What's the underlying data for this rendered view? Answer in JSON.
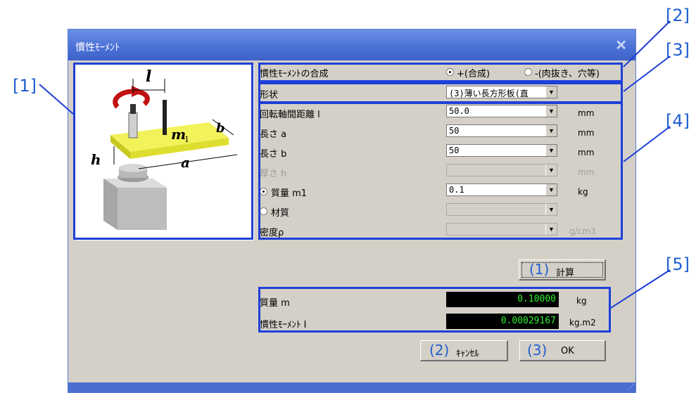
{
  "callouts": [
    "[1]",
    "[2]",
    "[3]",
    "[4]",
    "[5]"
  ],
  "dialog": {
    "title": "慣性ﾓｰﾒﾝﾄ",
    "close_icon": "close-x-icon"
  },
  "illustration": {
    "labels": {
      "l": "l",
      "b": "b",
      "m1": "m",
      "m1_sub": "1",
      "h": "h",
      "a": "a"
    }
  },
  "composition": {
    "label": "慣性ﾓｰﾒﾝﾄの合成",
    "option_plus": "+(合成)",
    "option_minus": "-(肉抜き、穴等)",
    "selected": "plus"
  },
  "shape": {
    "label": "形状",
    "value": "(3)薄い長方形板(直"
  },
  "fields": [
    {
      "label": "回転軸間距離 l",
      "value": "50.0",
      "unit": "mm",
      "enabled": true
    },
    {
      "label": "長さ a",
      "value": "50",
      "unit": "mm",
      "enabled": true
    },
    {
      "label": "長さ b",
      "value": "50",
      "unit": "mm",
      "enabled": true
    },
    {
      "label": "厚さ h",
      "value": "",
      "unit": "mm",
      "enabled": false
    },
    {
      "label": "質量 m1",
      "value": "0.1",
      "unit": "kg",
      "enabled": true
    },
    {
      "label": "材質",
      "value": "",
      "unit": "",
      "enabled": false
    },
    {
      "label": "密度ρ",
      "value": "",
      "unit": "g/cm3",
      "enabled": false
    }
  ],
  "mass_mode": "mass",
  "buttons": {
    "calc_num": "(1)",
    "calc_label": "計算",
    "cancel_num": "(2)",
    "cancel_label": "ｷｬﾝｾﾙ",
    "ok_num": "(3)",
    "ok_label": "OK"
  },
  "results": [
    {
      "label": "質量 m",
      "value": "0.10000",
      "unit": "kg"
    },
    {
      "label": "慣性ﾓｰﾒﾝﾄ I",
      "value": "0.00029167",
      "unit": "kg.m2"
    }
  ],
  "colors": {
    "accent": "#1e3fd8",
    "callout": "#1f5fd0",
    "output_text": "#2df02d"
  }
}
